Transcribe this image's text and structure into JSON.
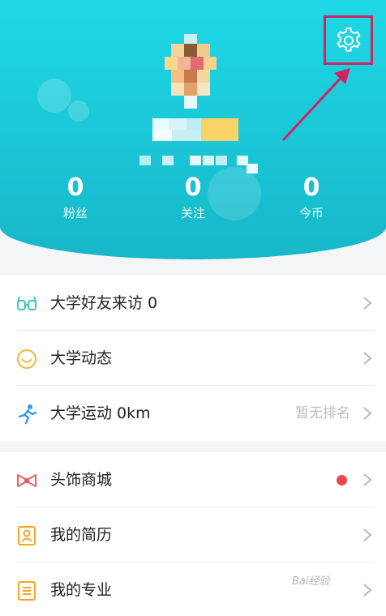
{
  "colors": {
    "header_gradient_top": "#1fd8e6",
    "header_gradient_bottom": "#17b7c8",
    "highlight_box": "#d0245e",
    "notification_dot": "#f0454f"
  },
  "profile": {
    "avatar_icon": "pixelated-avatar",
    "name_obscured": true
  },
  "settings": {
    "icon": "gear-icon"
  },
  "stats": [
    {
      "value": "0",
      "label": "粉丝"
    },
    {
      "value": "0",
      "label": "关注"
    },
    {
      "value": "0",
      "label": "今币"
    }
  ],
  "menu_group_1": [
    {
      "icon": "glasses-icon",
      "title": "大学好友来访  0",
      "extra": ""
    },
    {
      "icon": "smiley-icon",
      "title": "大学动态",
      "extra": ""
    },
    {
      "icon": "running-person-icon",
      "title": "大学运动  0km",
      "extra": "暂无排名"
    }
  ],
  "menu_group_2": [
    {
      "icon": "bow-tie-icon",
      "title": "头饰商城",
      "extra": "",
      "badge_dot": true
    },
    {
      "icon": "resume-icon",
      "title": "我的简历",
      "extra": ""
    },
    {
      "icon": "list-icon",
      "title": "我的专业",
      "extra": ""
    }
  ],
  "watermark": "Bai经验"
}
